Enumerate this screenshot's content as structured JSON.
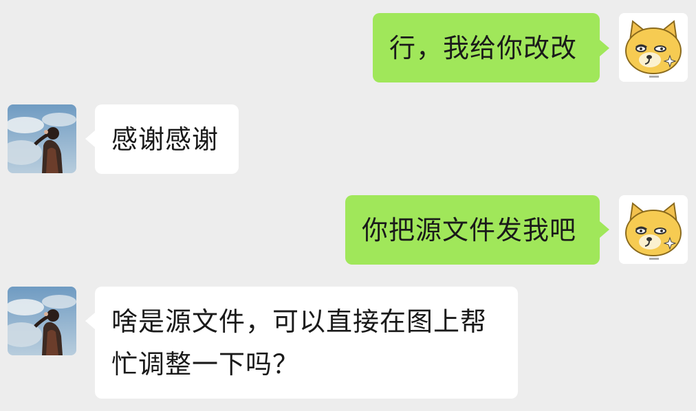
{
  "conversation": {
    "messages": [
      {
        "side": "outgoing",
        "text": "行，我给你改改",
        "avatar": "doge-avatar"
      },
      {
        "side": "incoming",
        "text": "感谢感谢",
        "avatar": "photo-avatar"
      },
      {
        "side": "outgoing",
        "text": "你把源文件发我吧",
        "avatar": "doge-avatar"
      },
      {
        "side": "incoming",
        "text": "啥是源文件，可以直接在图上帮忙调整一下吗？",
        "avatar": "photo-avatar"
      }
    ]
  },
  "colors": {
    "background": "#ededed",
    "outgoing_bubble": "#a0e75a",
    "incoming_bubble": "#ffffff",
    "text": "#1a1a1a"
  }
}
